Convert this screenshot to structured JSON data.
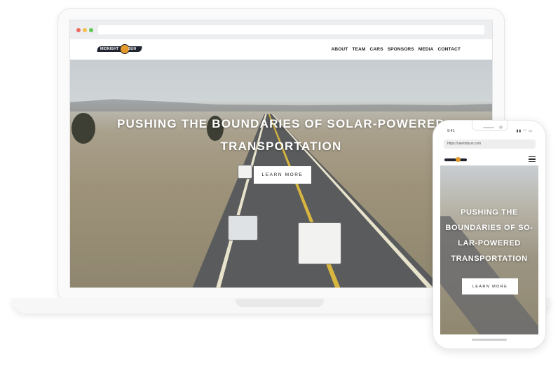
{
  "site": {
    "logo_left": "MIDNIGHT",
    "logo_right": "SUN",
    "nav": [
      "ABOUT",
      "TEAM",
      "CARS",
      "SPONSORS",
      "MEDIA",
      "CONTACT"
    ]
  },
  "hero": {
    "title_line1": "PUSHING THE BOUNDARIES OF SOLAR-POWERED",
    "title_line2": "TRANSPORTATION",
    "button_label": "LEARN MORE"
  },
  "phone": {
    "time": "9:41",
    "url": "https://uwmidsun.com",
    "title_lines": [
      "PUSHING THE",
      "BOUNDARIES OF SO-",
      "LAR-POWERED",
      "TRANSPORTATION"
    ],
    "button_label": "LEARN MORE"
  },
  "colors": {
    "brand_dark": "#1f2430",
    "brand_sun": "#e39a2a"
  }
}
